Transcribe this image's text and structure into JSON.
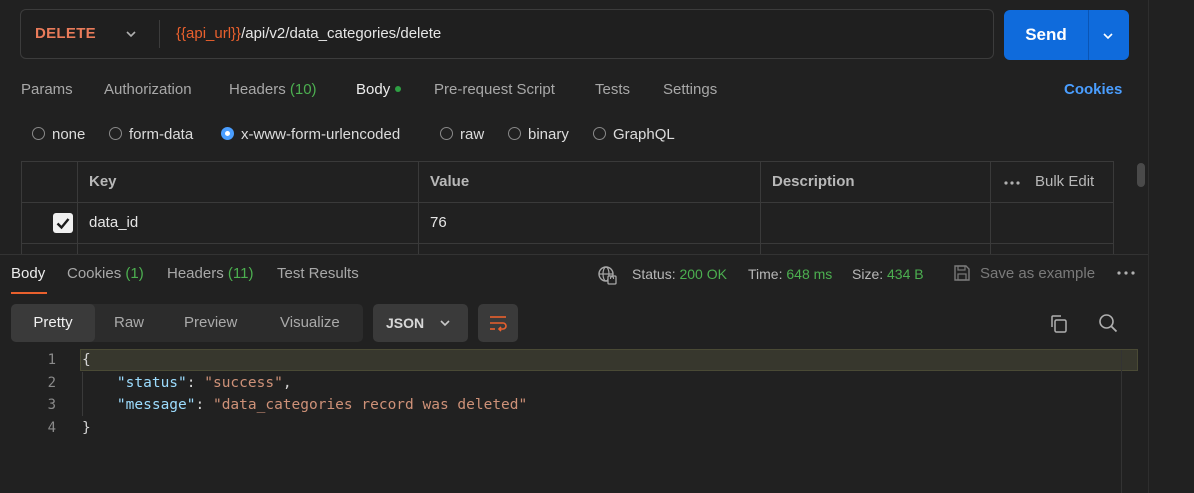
{
  "request": {
    "method": "DELETE",
    "url_variable": "{{api_url}}",
    "url_path": "/api/v2/data_categories/delete",
    "send_label": "Send"
  },
  "request_tabs": [
    {
      "label": "Params"
    },
    {
      "label": "Authorization"
    },
    {
      "label": "Headers",
      "count": "(10)"
    },
    {
      "label": "Body",
      "active": true
    },
    {
      "label": "Pre-request Script"
    },
    {
      "label": "Tests"
    },
    {
      "label": "Settings"
    }
  ],
  "cookies_link": "Cookies",
  "body_types": [
    "none",
    "form-data",
    "x-www-form-urlencoded",
    "raw",
    "binary",
    "GraphQL"
  ],
  "body_type_selected": "x-www-form-urlencoded",
  "params_table": {
    "headers": {
      "key": "Key",
      "value": "Value",
      "description": "Description",
      "bulk_edit": "Bulk Edit"
    },
    "rows": [
      {
        "checked": true,
        "key": "data_id",
        "value": "76",
        "description": ""
      }
    ]
  },
  "response": {
    "tabs": [
      {
        "label": "Body",
        "active": true
      },
      {
        "label": "Cookies",
        "count": "(1)"
      },
      {
        "label": "Headers",
        "count": "(11)"
      },
      {
        "label": "Test Results"
      }
    ],
    "status_label": "Status:",
    "status_value": "200 OK",
    "time_label": "Time:",
    "time_value": "648 ms",
    "size_label": "Size:",
    "size_value": "434 B",
    "save_example": "Save as example",
    "view_modes": [
      "Pretty",
      "Raw",
      "Preview",
      "Visualize"
    ],
    "format": "JSON",
    "code_lines": [
      {
        "num": "1",
        "text": "{"
      },
      {
        "num": "2",
        "key": "\"status\"",
        "value": "\"success\""
      },
      {
        "num": "3",
        "key": "\"message\"",
        "value": "\"data_categories record was deleted\""
      },
      {
        "num": "4",
        "text": "}"
      }
    ]
  },
  "colors": {
    "background": "#212121",
    "accent": "#0f6bdc",
    "method": "#e97b5a",
    "success": "#4caf50",
    "link": "#4a9eff"
  }
}
